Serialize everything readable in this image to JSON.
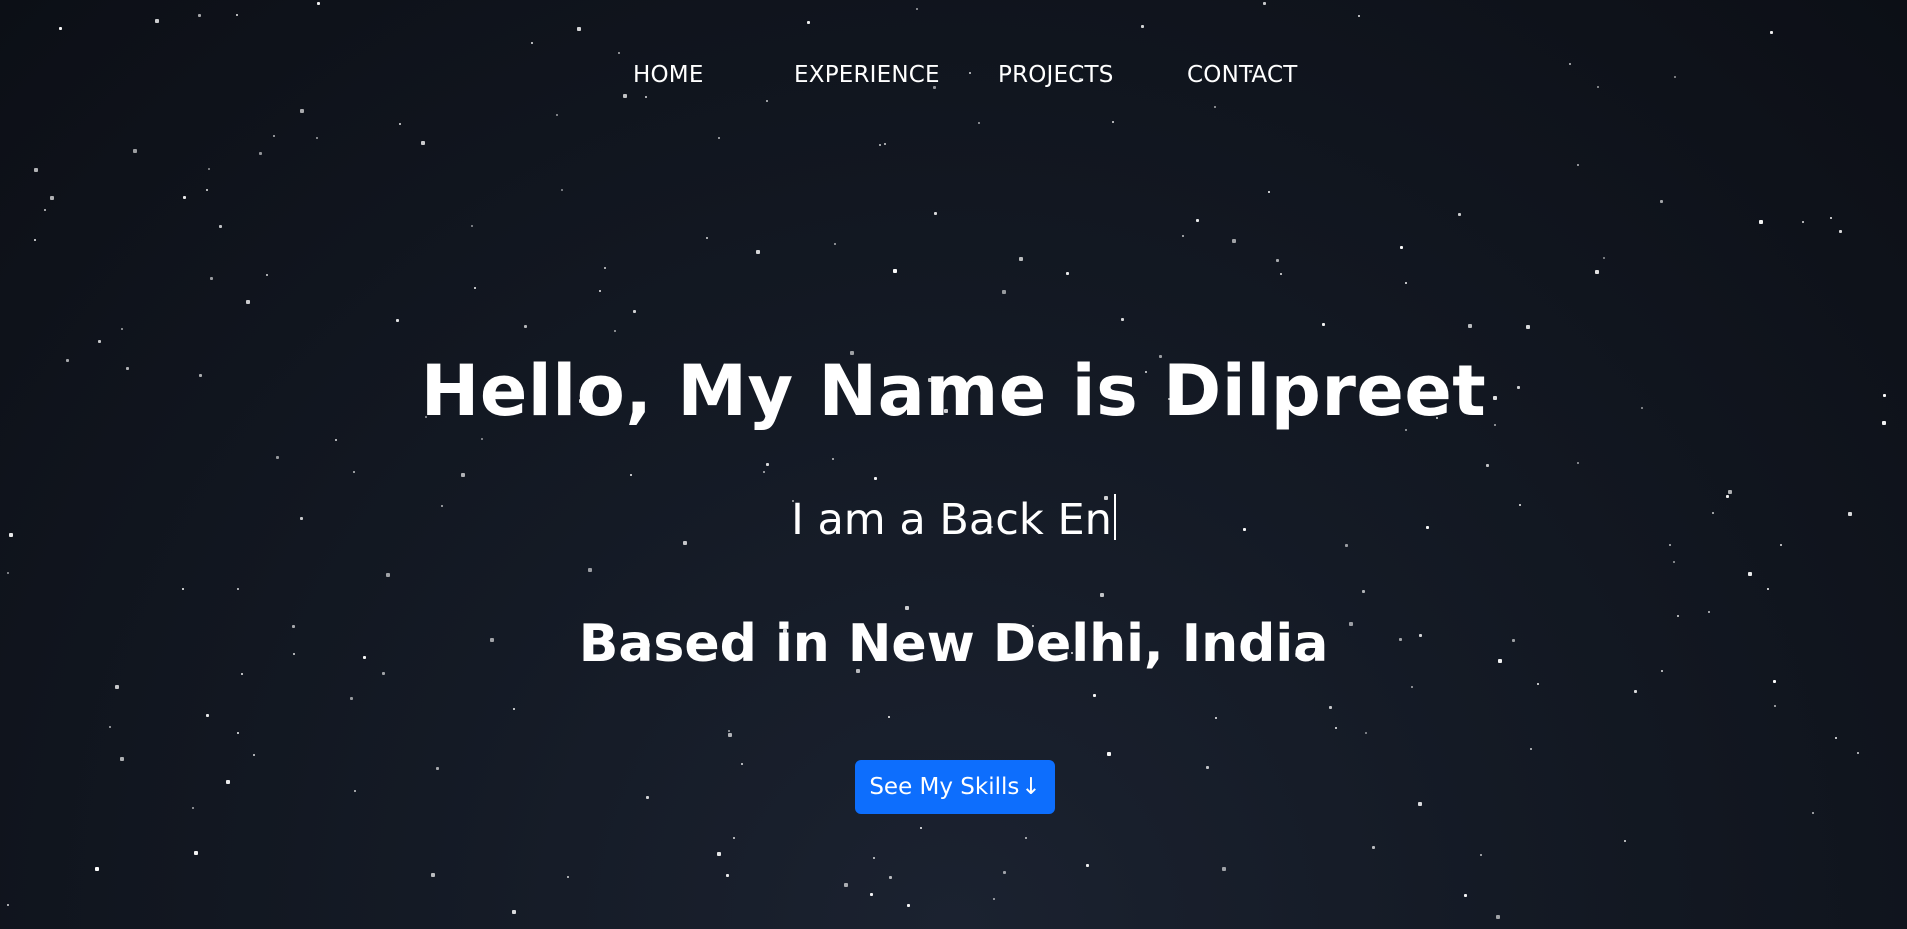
{
  "nav": {
    "items": [
      {
        "label": "HOME"
      },
      {
        "label": "EXPERIENCE"
      },
      {
        "label": "PROJECTS"
      },
      {
        "label": "CONTACT"
      }
    ]
  },
  "hero": {
    "title": "Hello, My Name is Dilpreet",
    "typed_text": "I am a Back En",
    "location": "Based in New Delhi, India",
    "cta_label": "See My Skills",
    "cta_icon": "arrow-down-icon"
  },
  "colors": {
    "background": "#0c0f16",
    "accent": "#0d6efd",
    "text": "#ffffff"
  }
}
